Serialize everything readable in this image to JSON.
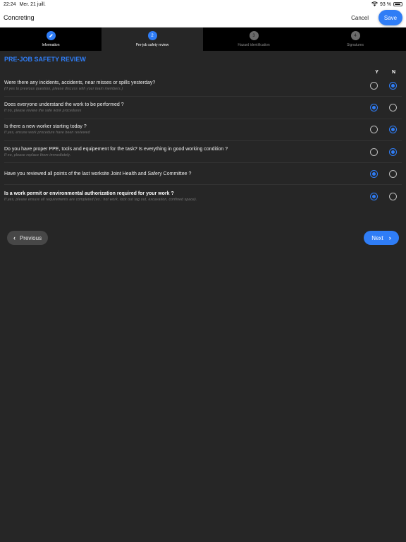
{
  "status_bar": {
    "time": "22:24",
    "date": "Mer. 21 juill.",
    "battery": "93 %",
    "wifi_icon": "wifi-icon",
    "battery_icon": "battery-icon"
  },
  "header": {
    "title": "Concreting",
    "cancel_label": "Cancel",
    "save_label": "Save"
  },
  "stepper": {
    "steps": [
      {
        "number": "",
        "label": "Information",
        "state": "done",
        "icon": "pencil-icon"
      },
      {
        "number": "2",
        "label": "Pre-job safety review",
        "state": "active"
      },
      {
        "number": "3",
        "label": "Hazard identification",
        "state": "pending"
      },
      {
        "number": "4",
        "label": "Signatures",
        "state": "pending"
      }
    ]
  },
  "main": {
    "section_title": "PRE-JOB SAFETY REVIEW",
    "col_yes": "Y",
    "col_no": "N",
    "questions": [
      {
        "text": "Were there any incidents, accidents, near misses or spills yesterday?",
        "hint": "(If yes to previous question, please discuss with your team members.)",
        "answer": "N"
      },
      {
        "text": "Does everyone understand the work to be performed ?",
        "hint": "If no, please review the safe work procedures",
        "answer": "Y"
      },
      {
        "text": "Is there a new worker starting today ?",
        "hint": "If yes, ensure work procedure have been reviewed",
        "answer": "N"
      },
      {
        "text": "Do you have proper PPE, tools and equipement for the task? Is everything in good working condition ?",
        "hint": "If no, please replace them immediately.",
        "answer": "N"
      },
      {
        "text": "Have you reviewed all points of the last worksite Joint Health and Safery Committee ?",
        "hint": "",
        "answer": "Y"
      },
      {
        "text": "Is a work permit or environmental authorization required for your work ?",
        "hint": "If yes, please ensure all requirements are completed (ex.: hot work, lock out tag out, excavation, confined space).",
        "answer": "Y"
      }
    ]
  },
  "footer": {
    "previous_label": "Previous",
    "next_label": "Next"
  },
  "colors": {
    "accent": "#2f7df6",
    "background": "#262626",
    "stepper_bg": "#000000"
  }
}
